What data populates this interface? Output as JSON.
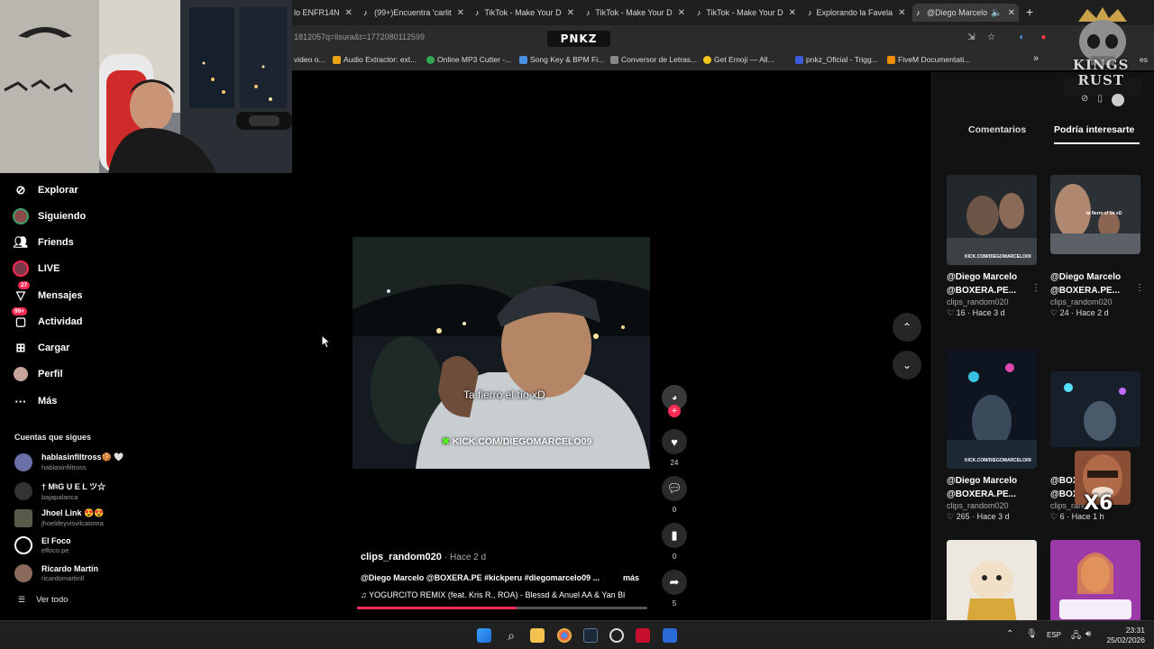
{
  "browser": {
    "tabs": [
      {
        "label": "lo ENFR14N"
      },
      {
        "label": "(99+)Encuentra 'carlit"
      },
      {
        "label": "TikTok - Make Your D"
      },
      {
        "label": "TikTok - Make Your D"
      },
      {
        "label": "TikTok - Make Your D"
      },
      {
        "label": "Explorando la Favela"
      },
      {
        "label": "@Diego Marcelo"
      }
    ],
    "new_tab": "+",
    "url": "1812057q=lisura&t=1772080112599",
    "overlay_logo": "PNKZ",
    "bookmarks": [
      {
        "label": "video o..."
      },
      {
        "label": "Audio Extractor: ext..."
      },
      {
        "label": "Online MP3 Cutter -..."
      },
      {
        "label": "Song Key & BPM Fi..."
      },
      {
        "label": "Conversor de Letras..."
      },
      {
        "label": "Get Emoji — All..."
      },
      {
        "label": "pnkz_Oficial - Trigg..."
      },
      {
        "label": "FiveM Documentati..."
      },
      {
        "label": "»"
      }
    ],
    "bookmarks_tail": "es"
  },
  "nav": {
    "items": [
      {
        "label": "Explorar",
        "icon": "compass-icon"
      },
      {
        "label": "Siguiendo",
        "icon": "avatar-icon"
      },
      {
        "label": "Friends",
        "icon": "friends-icon"
      },
      {
        "label": "LIVE",
        "icon": "live-icon"
      },
      {
        "label": "Mensajes",
        "icon": "messages-icon",
        "badge": "27"
      },
      {
        "label": "Actividad",
        "icon": "activity-icon",
        "badge": "99+"
      },
      {
        "label": "Cargar",
        "icon": "upload-icon"
      },
      {
        "label": "Perfil",
        "icon": "profile-icon"
      },
      {
        "label": "Más",
        "icon": "more-icon"
      }
    ],
    "following_title": "Cuentas que sigues",
    "accounts": [
      {
        "name": "hablasinfiltross🍪 🤍",
        "handle": "hablasinfiltross"
      },
      {
        "name": "† M♮G U E L ツ☆",
        "handle": "bajapalanca"
      },
      {
        "name": "Jhoel Link 😍😍",
        "handle": "jhoeldeyvisvilcatoma"
      },
      {
        "name": "El Foco",
        "handle": "elfoco.pe"
      },
      {
        "name": "Ricardo Martín",
        "handle": "ricardomartinll"
      }
    ],
    "see_all": "Ver todo"
  },
  "video": {
    "caption": "Ta fierro el tío xD",
    "watermark": "KICK.COM/DIEGOMARCELO09",
    "author": "clips_random020",
    "time": "· Hace 2 d",
    "description": "@Diego Marcelo @BOXERA.PE #kickperu #diegomarcelo09 ...",
    "more": "más",
    "music": "♫  YOGURCITO REMIX (feat. Kris R., ROA) - Blessd & Anuel AA & Yan Bl",
    "progress": 0.55,
    "likes": "24",
    "comments": "0",
    "saves": "0",
    "shares": "5"
  },
  "right_panel": {
    "tabs": [
      "Comentarios",
      "Podría interesarte"
    ],
    "active_tab": 1,
    "cards": [
      {
        "line1": "@Diego Marcelo",
        "line2": "@BOXERA.PE...",
        "user": "clips_random020",
        "stats": "♡ 16  · Hace 3 d"
      },
      {
        "line1": "@Diego Marcelo",
        "line2": "@BOXERA.PE...",
        "user": "clips_random020",
        "stats": "♡ 24  · Hace 2 d"
      },
      {
        "line1": "@Diego Marcelo",
        "line2": "@BOXERA.PE...",
        "user": "clips_random020",
        "stats": "♡ 265  · Hace 3 d"
      },
      {
        "line1": "@BOX",
        "line2": "@BOX",
        "user": "clips_rand",
        "stats": "♡ 6  · Hace 1 h"
      }
    ],
    "thumb_texts": [
      "KICK.COM/DIEGOMARCELO09",
      "ta fierro el tío xD",
      "KICK.COM/DIEGOMARCELO09",
      ""
    ]
  },
  "overlays": {
    "kings_rust": [
      "KINGS",
      "RUST"
    ],
    "multiplier": "X6"
  },
  "taskbar": {
    "lang": "ESP",
    "time": "23:31",
    "date": "25/02/2026"
  },
  "colors": {
    "accent": "#fe2c55",
    "kick_green": "#53fc18",
    "bg": "#000000",
    "panel": "#121212"
  }
}
